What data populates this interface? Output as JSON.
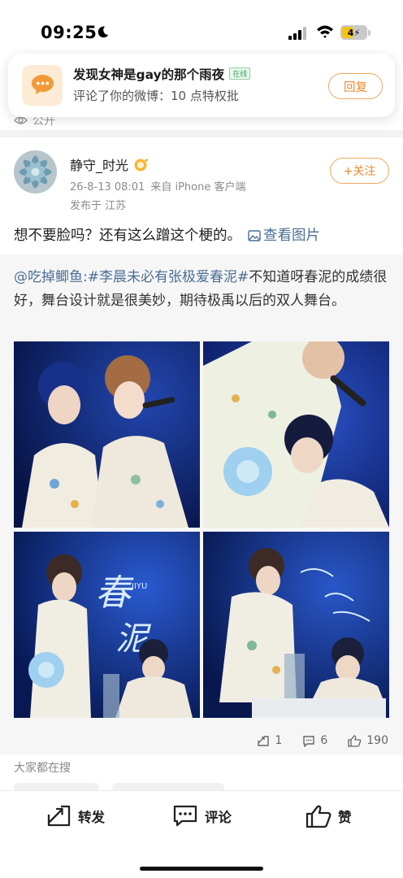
{
  "status_bar": {
    "time": "09:25",
    "battery": "4"
  },
  "notification": {
    "title": "发现女神是gay的那个雨夜",
    "badge": "在线",
    "text": "评论了你的微博：10 点特权批",
    "reply_label": "回复"
  },
  "visibility": {
    "label": "公开"
  },
  "post": {
    "username": "静守_时光",
    "date": "26-8-13 08:01",
    "source": "来自 iPhone 客户端",
    "location": "发布于 江苏",
    "follow_label": "+关注",
    "text": "想不要脸吗？还有这么蹭这个梗的。",
    "view_image_label": "查看图片"
  },
  "repost": {
    "author": "@吃掉鲫鱼:",
    "topic": "#李晨未必有张极爱春泥#",
    "text": "不知道呀春泥的成绩很好，舞台设计就是很美妙，期待极禹以后的双人舞台。",
    "image_captions": [
      "春",
      "泥",
      "JIYU"
    ],
    "stats": {
      "reposts": "1",
      "comments": "6",
      "likes": "190"
    }
  },
  "search": {
    "label": "大家都在搜"
  },
  "actions": {
    "repost": "转发",
    "comment": "评论",
    "like": "赞"
  },
  "colors": {
    "accent": "#ee8a2f",
    "link": "#4a6e95",
    "stage_blue": "#0f2d8f"
  }
}
